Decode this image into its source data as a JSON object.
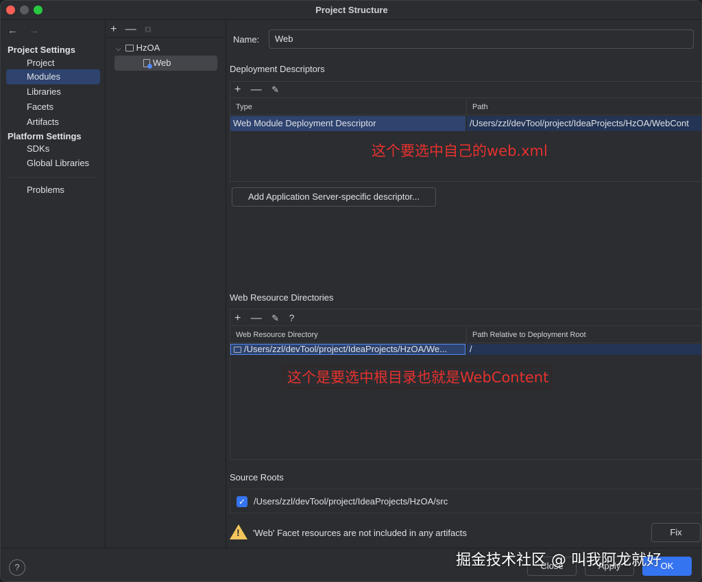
{
  "window": {
    "title": "Project Structure"
  },
  "nav": {
    "back": "←",
    "forward": "→",
    "project_settings": "Project Settings",
    "platform_settings": "Platform Settings",
    "items": {
      "project": "Project",
      "modules": "Modules",
      "libraries": "Libraries",
      "facets": "Facets",
      "artifacts": "Artifacts",
      "sdks": "SDKs",
      "global_libraries": "Global Libraries",
      "problems": "Problems"
    }
  },
  "tree": {
    "add": "+",
    "remove": "—",
    "copy": "⧉",
    "root": "HzOA",
    "child": "Web"
  },
  "main": {
    "name_label": "Name:",
    "name_value": "Web",
    "deployment": {
      "title": "Deployment Descriptors",
      "columns": [
        "Type",
        "Path"
      ],
      "rows": [
        {
          "type": "Web Module Deployment Descriptor",
          "path": "/Users/zzl/devTool/project/IdeaProjects/HzOA/WebCont"
        }
      ],
      "add_button": "Add Application Server-specific descriptor..."
    },
    "web_resources": {
      "title": "Web Resource Directories",
      "columns": [
        "Web Resource Directory",
        "Path Relative to Deployment Root"
      ],
      "rows": [
        {
          "dir": "/Users/zzl/devTool/project/IdeaProjects/HzOA/We...",
          "rel": "/"
        }
      ]
    },
    "source_roots": {
      "title": "Source Roots",
      "path": "/Users/zzl/devTool/project/IdeaProjects/HzOA/src",
      "checked": true
    },
    "warning": {
      "text": "'Web' Facet resources are not included in any artifacts",
      "fix_button": "Fix"
    }
  },
  "annotations": {
    "deployment": "这个要选中自己的web.xml",
    "web_resource": "这个是要选中根目录也就是WebContent"
  },
  "footer": {
    "help": "?",
    "close": "Close",
    "apply": "Apply",
    "ok": "OK",
    "watermark": "掘金技术社区 @ 叫我阿龙就好"
  },
  "toolbar_icons": {
    "add": "+",
    "remove": "—",
    "edit": "✎",
    "help": "?"
  }
}
